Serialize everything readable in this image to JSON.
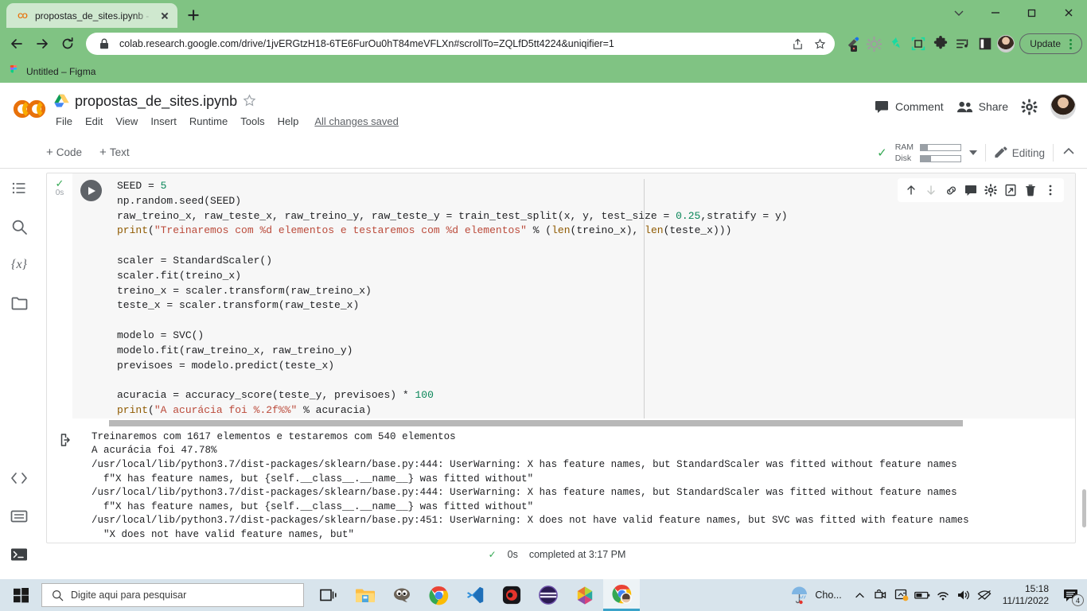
{
  "browser": {
    "tab": {
      "title": "propostas_de_sites.ipynb - Colab",
      "favicon": "colab-icon"
    },
    "newtab_label": "+",
    "url": "colab.research.google.com/drive/1jvERGtzH18-6TE6FurOu0hT84meVFLXn#scrollTo=ZQLfD5tt4224&uniqifier=1",
    "update_label": "Update",
    "bookmark": {
      "label": "Untitled – Figma"
    },
    "theme_color": "#80c383",
    "tab_color": "#cfe8cf"
  },
  "colab": {
    "logo": "CO",
    "notebook_title": "propostas_de_sites.ipynb",
    "menu": [
      "File",
      "Edit",
      "View",
      "Insert",
      "Runtime",
      "Tools",
      "Help"
    ],
    "save_status": "All changes saved",
    "comment_label": "Comment",
    "share_label": "Share",
    "toolbar": {
      "add_code": "Code",
      "add_text": "Text",
      "plus": "+",
      "ram_label": "RAM",
      "disk_label": "Disk",
      "ram_fill_pct": 18,
      "disk_fill_pct": 26,
      "editing_label": "Editing"
    },
    "rail_icons": [
      {
        "name": "table-of-contents-icon"
      },
      {
        "name": "search-icon"
      },
      {
        "name": "variables-icon",
        "glyph": "{x}"
      },
      {
        "name": "files-folder-icon"
      },
      {
        "name": "code-snippets-icon",
        "glyph": "<>"
      },
      {
        "name": "command-palette-icon"
      },
      {
        "name": "terminal-icon",
        "glyph": ">_"
      }
    ],
    "cell": {
      "exec_check": "✓",
      "exec_time": "0s",
      "code": "SEED = 5\nnp.random.seed(SEED)\nraw_treino_x, raw_teste_x, raw_treino_y, raw_teste_y = train_test_split(x, y, test_size = 0.25,stratify = y)\nprint(\"Treinaremos com %d elementos e testaremos com %d elementos\" % (len(treino_x), len(teste_x)))\n\nscaler = StandardScaler()\nscaler.fit(treino_x)\ntreino_x = scaler.transform(raw_treino_x)\nteste_x = scaler.transform(raw_teste_x)\n\nmodelo = SVC()\nmodelo.fit(raw_treino_x, raw_treino_y)\nprevisoes = modelo.predict(teste_x)\n\nacuracia = accuracy_score(teste_y, previsoes) * 100\nprint(\"A acurácia foi %.2f%%\" % acuracia)",
      "output": "Treinaremos com 1617 elementos e testaremos com 540 elementos\nA acurácia foi 47.78%\n/usr/local/lib/python3.7/dist-packages/sklearn/base.py:444: UserWarning: X has feature names, but StandardScaler was fitted without feature names\n  f\"X has feature names, but {self.__class__.__name__} was fitted without\"\n/usr/local/lib/python3.7/dist-packages/sklearn/base.py:444: UserWarning: X has feature names, but StandardScaler was fitted without feature names\n  f\"X has feature names, but {self.__class__.__name__} was fitted without\"\n/usr/local/lib/python3.7/dist-packages/sklearn/base.py:451: UserWarning: X does not have valid feature names, but SVC was fitted with feature names\n  \"X does not have valid feature names, but\"",
      "toolbar_icons": [
        {
          "name": "move-cell-up-icon"
        },
        {
          "name": "move-cell-down-icon"
        },
        {
          "name": "link-to-cell-icon"
        },
        {
          "name": "add-comment-icon"
        },
        {
          "name": "cell-settings-icon"
        },
        {
          "name": "open-in-new-tab-icon"
        },
        {
          "name": "delete-cell-icon"
        },
        {
          "name": "more-cell-actions-icon"
        }
      ]
    },
    "status": {
      "check": "✓",
      "duration": "0s",
      "completed": "completed at 3:17 PM"
    }
  },
  "taskbar": {
    "search_placeholder": "Digite aqui para pesquisar",
    "weather_label": "Cho...",
    "time": "15:18",
    "date": "11/11/2022",
    "notification_count": "4",
    "apps": [
      {
        "name": "task-view-icon"
      },
      {
        "name": "file-explorer-icon"
      },
      {
        "name": "gimp-icon"
      },
      {
        "name": "chrome-icon"
      },
      {
        "name": "vscode-icon"
      },
      {
        "name": "recording-app-icon"
      },
      {
        "name": "purple-app-icon"
      },
      {
        "name": "hexagon-app-icon"
      },
      {
        "name": "chrome-active-icon"
      }
    ]
  }
}
